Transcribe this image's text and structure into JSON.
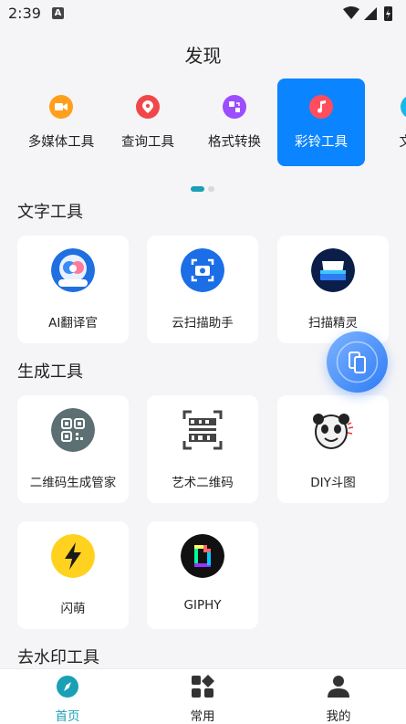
{
  "status": {
    "time": "2:39",
    "notif_letter": "A"
  },
  "header": {
    "title": "发现"
  },
  "categories": [
    {
      "label": "多媒体工具",
      "icon": "video-icon",
      "color": "#ff9f1c"
    },
    {
      "label": "查询工具",
      "icon": "location-icon",
      "color": "#f0484a"
    },
    {
      "label": "格式转换",
      "icon": "convert-icon",
      "color": "#9b4dff"
    },
    {
      "label": "彩铃工具",
      "icon": "music-note-icon",
      "color": "#ff4d5e",
      "active": true
    },
    {
      "label": "文字",
      "icon": "text-icon",
      "color": "#19b8e6"
    }
  ],
  "sections": [
    {
      "title": "文字工具",
      "items": [
        {
          "label": "AI翻译官",
          "icon": "ai-translator-icon"
        },
        {
          "label": "云扫描助手",
          "icon": "cloud-scan-icon"
        },
        {
          "label": "扫描精灵",
          "icon": "scanner-icon"
        }
      ]
    },
    {
      "title": "生成工具",
      "items": [
        {
          "label": "二维码生成管家",
          "icon": "qr-generator-icon"
        },
        {
          "label": "艺术二维码",
          "icon": "art-qr-icon"
        },
        {
          "label": "DIY斗图",
          "icon": "panda-meme-icon"
        },
        {
          "label": "闪萌",
          "icon": "lightning-icon"
        },
        {
          "label": "GIPHY",
          "icon": "giphy-icon"
        }
      ]
    },
    {
      "title": "去水印工具",
      "items": []
    }
  ],
  "ai_translator_badge": "AI翻译官",
  "bottom_nav": [
    {
      "label": "首页",
      "icon": "compass-icon",
      "active": true
    },
    {
      "label": "常用",
      "icon": "apps-grid-icon"
    },
    {
      "label": "我的",
      "icon": "person-icon"
    }
  ],
  "colors": {
    "accent": "#0a84ff",
    "nav_active": "#1aa0b5"
  }
}
